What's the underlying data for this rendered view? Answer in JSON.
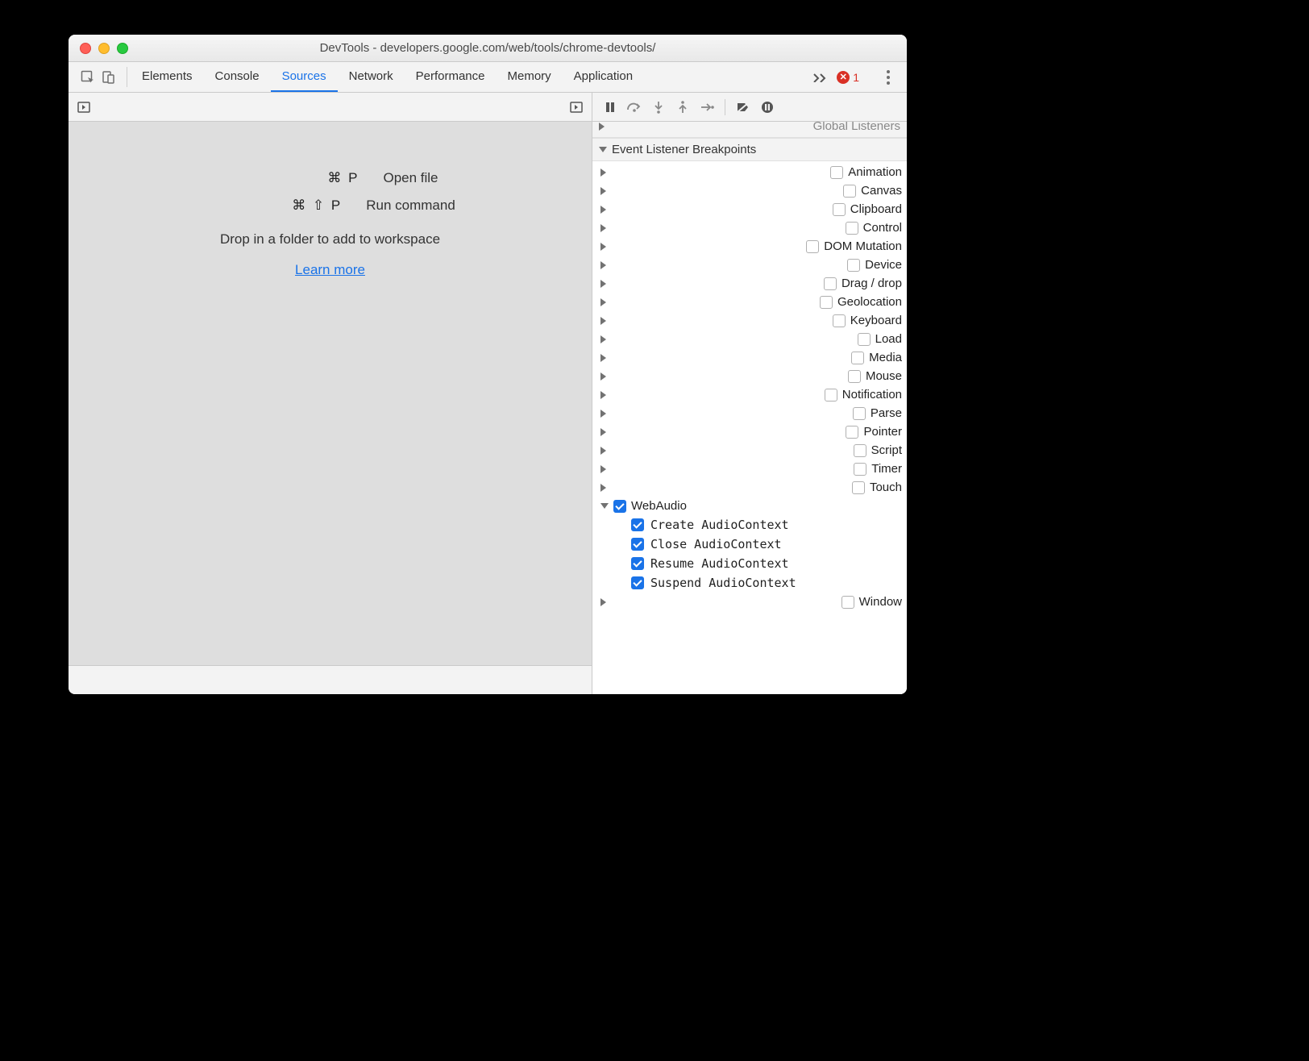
{
  "window": {
    "title": "DevTools - developers.google.com/web/tools/chrome-devtools/"
  },
  "tabs": {
    "items": [
      "Elements",
      "Console",
      "Sources",
      "Network",
      "Performance",
      "Memory",
      "Application"
    ],
    "active": "Sources",
    "error_count": "1"
  },
  "sources_empty": {
    "open_file_keys": "⌘ P",
    "open_file_label": "Open file",
    "run_cmd_keys": "⌘ ⇧ P",
    "run_cmd_label": "Run command",
    "drop_msg": "Drop in a folder to add to workspace",
    "learn_more": "Learn more"
  },
  "debugger_sections": {
    "global_listeners": "Global Listeners",
    "event_listener_breakpoints": "Event Listener Breakpoints"
  },
  "breakpoint_categories": [
    {
      "label": "Animation",
      "checked": false,
      "expanded": false
    },
    {
      "label": "Canvas",
      "checked": false,
      "expanded": false
    },
    {
      "label": "Clipboard",
      "checked": false,
      "expanded": false
    },
    {
      "label": "Control",
      "checked": false,
      "expanded": false
    },
    {
      "label": "DOM Mutation",
      "checked": false,
      "expanded": false
    },
    {
      "label": "Device",
      "checked": false,
      "expanded": false
    },
    {
      "label": "Drag / drop",
      "checked": false,
      "expanded": false
    },
    {
      "label": "Geolocation",
      "checked": false,
      "expanded": false
    },
    {
      "label": "Keyboard",
      "checked": false,
      "expanded": false
    },
    {
      "label": "Load",
      "checked": false,
      "expanded": false
    },
    {
      "label": "Media",
      "checked": false,
      "expanded": false
    },
    {
      "label": "Mouse",
      "checked": false,
      "expanded": false
    },
    {
      "label": "Notification",
      "checked": false,
      "expanded": false
    },
    {
      "label": "Parse",
      "checked": false,
      "expanded": false
    },
    {
      "label": "Pointer",
      "checked": false,
      "expanded": false
    },
    {
      "label": "Script",
      "checked": false,
      "expanded": false
    },
    {
      "label": "Timer",
      "checked": false,
      "expanded": false
    },
    {
      "label": "Touch",
      "checked": false,
      "expanded": false
    },
    {
      "label": "WebAudio",
      "checked": true,
      "expanded": true,
      "children": [
        {
          "label": "Create AudioContext",
          "checked": true
        },
        {
          "label": "Close AudioContext",
          "checked": true
        },
        {
          "label": "Resume AudioContext",
          "checked": true
        },
        {
          "label": "Suspend AudioContext",
          "checked": true
        }
      ]
    },
    {
      "label": "Window",
      "checked": false,
      "expanded": false
    }
  ]
}
